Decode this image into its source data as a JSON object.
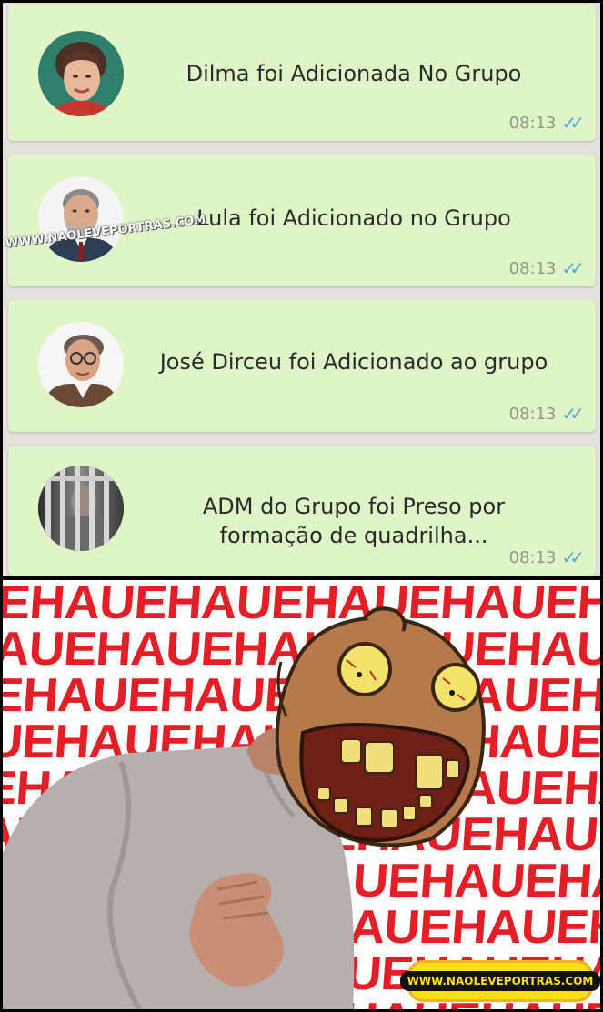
{
  "messages": [
    {
      "text": "Dilma foi Adicionada No Grupo",
      "time": "08:13",
      "status": "read-double-check",
      "avatar": "woman-portrait"
    },
    {
      "text": "Lula foi Adicionado no Grupo",
      "time": "08:13",
      "status": "read-double-check",
      "avatar": "bearded-man-portrait"
    },
    {
      "text": "José Dirceu foi Adicionado ao grupo",
      "time": "08:13",
      "status": "read-double-check",
      "avatar": "older-man-portrait"
    },
    {
      "text": "ADM do Grupo foi Preso por formação de quadrilha...",
      "time": "08:13",
      "status": "read-double-check",
      "avatar": "prison-bars"
    }
  ],
  "watermark_top": "WWW.NAOLEVEPORTRAS.COM",
  "watermark_bottom": "WWW.NAOLEVEPORTRAS.COM",
  "laugh_text": [
    "EHAUEHAUEHAUEHAUEHAUEHA",
    "AUEHAUEHAUEHAUEHAUEHAUEHAUEH",
    "EHAUEHAUEHAUEHAUEHAUEHA",
    "UEHAUEHAUEHAUEHAUEHAUEHAU",
    "EHAUEHAUEHAUEHAUEHAUEHA",
    "AUEHAUEHAUEHAUEHAUEHAUEHAUEH",
    "EHAUEHAUEHAUEHAUEHAUEHA",
    "UEHAUEHAUEHAUEHAUEHAUEHAU",
    "EHAUEHAUEHAUEHAUEHAUEHA",
    "AUEHAUEHAUEHAUEHAUEHAUEHAUEH"
  ],
  "colors": {
    "bubble": "#dff5c8",
    "chat_background": "#e3e0de",
    "ticks": "#4fa9e0",
    "laugh": "#e41e26"
  }
}
